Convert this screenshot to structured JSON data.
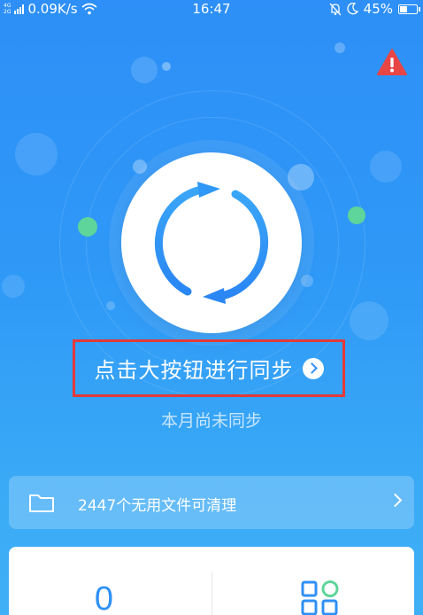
{
  "status_bar": {
    "network_type_top": "4G",
    "network_type_bottom": "2G",
    "speed": "0.09K/s",
    "time": "16:47",
    "battery": "45%",
    "battery_level": 0.45
  },
  "icons": {
    "warning": "warning-icon",
    "sync": "sync-icon",
    "folder": "folder-icon",
    "apps": "apps-icon"
  },
  "sync": {
    "cta_label": "点击大按钮进行同步",
    "subtitle": "本月尚未同步"
  },
  "cleanup": {
    "text": "2447个无用文件可清理"
  },
  "stats": {
    "count": "0"
  },
  "colors": {
    "background_top": "#2d8ff7",
    "accent": "#2f90f5",
    "highlight_box": "#e23a3a",
    "warning": "#e84545",
    "green": "#5ed59a"
  }
}
